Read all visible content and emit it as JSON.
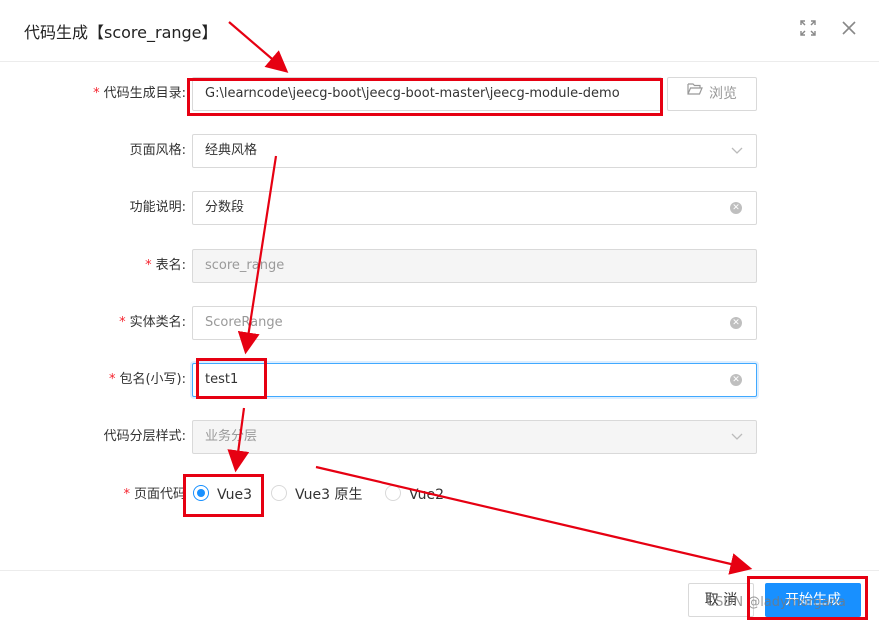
{
  "modal": {
    "title": "代码生成【score_range】",
    "fullscreen_icon": "expand-icon",
    "close_icon": "close-icon"
  },
  "form": {
    "dir": {
      "required": true,
      "label": "代码生成目录:",
      "value": "G:\\learncode\\jeecg-boot\\jeecg-boot-master\\jeecg-module-demo",
      "browse_label": "浏览",
      "browse_icon": "folder-open-icon"
    },
    "style": {
      "required": false,
      "label": "页面风格:",
      "value": "经典风格"
    },
    "desc": {
      "required": false,
      "label": "功能说明:",
      "value": "分数段"
    },
    "table": {
      "required": true,
      "label": "表名:",
      "value": "score_range"
    },
    "entity": {
      "required": true,
      "label": "实体类名:",
      "value": "ScoreRange"
    },
    "package": {
      "required": true,
      "label": "包名(小写):",
      "value": "test1"
    },
    "layer": {
      "required": false,
      "label": "代码分层样式:",
      "value": "业务分层"
    },
    "page_code": {
      "required": true,
      "label": "页面代码",
      "options": [
        {
          "label": "Vue3",
          "checked": true
        },
        {
          "label": "Vue3 原生",
          "checked": false
        },
        {
          "label": "Vue2",
          "checked": false
        }
      ]
    }
  },
  "footer": {
    "cancel_label": "取 消",
    "ok_label": "开始生成"
  },
  "watermark": "CSDN @ladymorgana",
  "colors": {
    "primary": "#1890ff",
    "required": "#f5222d",
    "annotation": "#e60012"
  }
}
